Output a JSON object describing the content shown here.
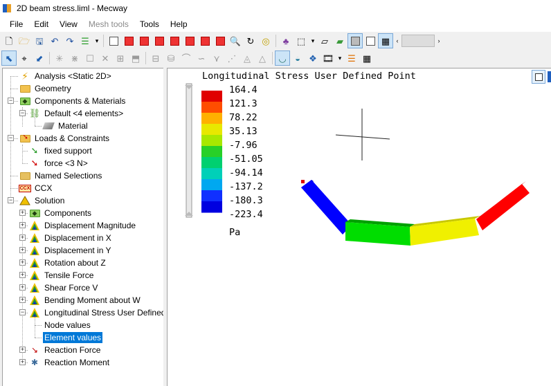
{
  "window": {
    "title": "2D beam stress.liml - Mecway"
  },
  "menu": {
    "items": [
      {
        "label": "File",
        "enabled": true
      },
      {
        "label": "Edit",
        "enabled": true
      },
      {
        "label": "View",
        "enabled": true
      },
      {
        "label": "Mesh tools",
        "enabled": false
      },
      {
        "label": "Tools",
        "enabled": true
      },
      {
        "label": "Help",
        "enabled": true
      }
    ]
  },
  "toolbar1": {
    "icons": [
      "new-file-icon",
      "open-folder-icon",
      "save-icon",
      "undo-icon",
      "redo-icon",
      "layers-icon",
      "dropdown-arrow-icon",
      "cube-wireframe-icon",
      "cube-front-icon",
      "cube-back-icon",
      "cube-top-icon",
      "cube-bottom-icon",
      "cube-left-icon",
      "cube-right-icon",
      "cube-iso-icon",
      "zoom-icon",
      "rotate-icon",
      "fit-view-icon",
      "render-style-icon",
      "display-options-icon",
      "plane-icon",
      "shaded-plane-icon",
      "solid-view-icon",
      "transparent-view-icon",
      "mesh-view-icon",
      "scroll-left-icon",
      "scroll-right-icon"
    ]
  },
  "toolbar2": {
    "icons": [
      "select-arrow-icon",
      "select-node-icon",
      "select-element-icon",
      "explode-icon",
      "collapse-icon",
      "box-icon",
      "delete-icon",
      "mirror-icon",
      "extrude-icon",
      "refine-icon",
      "revolve-icon",
      "sweep-icon",
      "merge-icon",
      "triangle-icon",
      "split-icon",
      "tetra-icon",
      "deform-view-icon",
      "contour-view-icon",
      "vector-view-icon",
      "animation-icon",
      "legend-icon",
      "table-icon"
    ]
  },
  "tree": {
    "nodes": [
      {
        "id": "analysis",
        "label": "Analysis <Static 2D>",
        "icon": "analysis-icon"
      },
      {
        "id": "geometry",
        "label": "Geometry",
        "icon": "folder-icon"
      },
      {
        "id": "components-materials",
        "label": "Components & Materials",
        "icon": "components-icon"
      },
      {
        "id": "default-component",
        "label": "Default <4 elements>",
        "icon": "component-icon"
      },
      {
        "id": "material",
        "label": "Material",
        "icon": "material-icon"
      },
      {
        "id": "loads-constraints",
        "label": "Loads & Constraints",
        "icon": "loads-folder-icon"
      },
      {
        "id": "fixed-support",
        "label": "fixed support",
        "icon": "constraint-icon"
      },
      {
        "id": "force",
        "label": "force <3 N>",
        "icon": "force-icon"
      },
      {
        "id": "named-selections",
        "label": "Named Selections",
        "icon": "named-selections-icon"
      },
      {
        "id": "ccx",
        "label": "CCX",
        "icon": "ccx-icon"
      },
      {
        "id": "solution",
        "label": "Solution",
        "icon": "solution-icon"
      },
      {
        "id": "sol-components",
        "label": "Components",
        "icon": "components-icon"
      },
      {
        "id": "displacement-magnitude",
        "label": "Displacement Magnitude",
        "icon": "result-icon"
      },
      {
        "id": "displacement-x",
        "label": "Displacement in X",
        "icon": "result-icon"
      },
      {
        "id": "displacement-y",
        "label": "Displacement in Y",
        "icon": "result-icon"
      },
      {
        "id": "rotation-z",
        "label": "Rotation about Z",
        "icon": "result-icon"
      },
      {
        "id": "tensile-force",
        "label": "Tensile Force",
        "icon": "result-icon"
      },
      {
        "id": "shear-force",
        "label": "Shear Force V",
        "icon": "result-icon"
      },
      {
        "id": "bending-moment",
        "label": "Bending Moment about W",
        "icon": "result-icon"
      },
      {
        "id": "long-stress",
        "label": "Longitudinal Stress User Defined",
        "icon": "result-icon"
      },
      {
        "id": "node-values",
        "label": "Node values",
        "icon": ""
      },
      {
        "id": "element-values",
        "label": "Element values",
        "icon": "",
        "selected": true
      },
      {
        "id": "reaction-force",
        "label": "Reaction Force",
        "icon": "reaction-force-icon"
      },
      {
        "id": "reaction-moment",
        "label": "Reaction Moment",
        "icon": "reaction-moment-icon"
      }
    ]
  },
  "viewport": {
    "legend_title": "Longitudinal Stress User Defined Point",
    "legend_values": [
      "164.4",
      "121.3",
      "78.22",
      "35.13",
      "-7.96",
      "-51.05",
      "-94.14",
      "-137.2",
      "-180.3",
      "-223.4"
    ],
    "legend_unit": "Pa",
    "legend_colors": [
      "#e00000",
      "#ff4d00",
      "#ffb000",
      "#e8e800",
      "#a8e800",
      "#28d028",
      "#00d070",
      "#00d0b8",
      "#00a8f0",
      "#1030ff",
      "#0000e0"
    ],
    "elements": [
      {
        "name": "element-1",
        "value": -223.4,
        "color": "#0000ff"
      },
      {
        "name": "element-2",
        "value": -7.96,
        "color": "#00dd00"
      },
      {
        "name": "element-3",
        "value": 35.13,
        "color": "#f0f000"
      },
      {
        "name": "element-4",
        "value": 164.4,
        "color": "#ff0000"
      }
    ]
  }
}
